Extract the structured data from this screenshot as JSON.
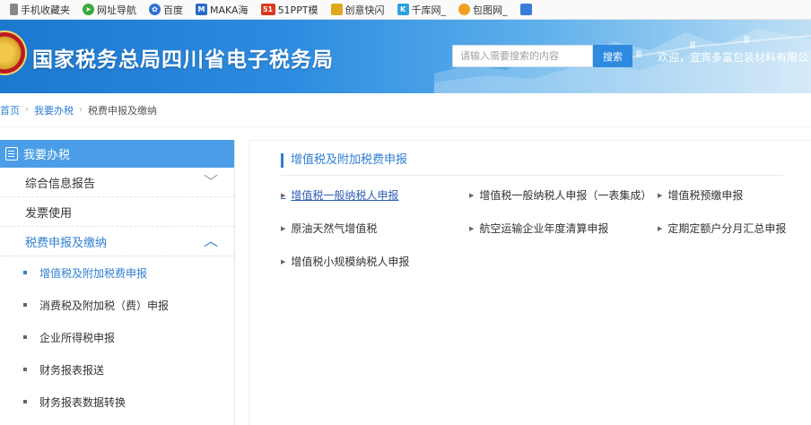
{
  "bookmarks": [
    {
      "label": "手机收藏夹",
      "icon": "phone-icon",
      "color": "#888888"
    },
    {
      "label": "网址导航",
      "icon": "compass-icon",
      "color": "#3aa83a"
    },
    {
      "label": "百度",
      "icon": "baidu-paw-icon",
      "color": "#2f6fd6"
    },
    {
      "label": "MAKA海",
      "icon": "maka-icon",
      "color": "#2a6bc9",
      "glyph": "M"
    },
    {
      "label": "51PPT模",
      "icon": "51ppt-icon",
      "color": "#d9391f",
      "glyph": "51"
    },
    {
      "label": "创意快闪",
      "icon": "folder-icon",
      "color": "#e0a81e"
    },
    {
      "label": "千库网_",
      "icon": "qianku-icon",
      "color": "#2ba3e0",
      "glyph": "K"
    },
    {
      "label": "包图网_",
      "icon": "baotu-icon",
      "color": "#f0a020"
    },
    {
      "label": "",
      "icon": "image-bookmark-icon",
      "color": "#3b7bd9"
    }
  ],
  "header": {
    "site_title": "国家税务总局四川省电子税务局",
    "search_placeholder": "请输入需要搜索的内容",
    "search_button": "搜索",
    "welcome": "欢迎，宜宾多富包装材料有限公"
  },
  "breadcrumb": [
    "首页",
    "我要办税",
    "税费申报及缴纳"
  ],
  "sidebar": {
    "header": "我要办税",
    "sections": [
      {
        "label": "综合信息报告",
        "expanded": false
      },
      {
        "label": "发票使用",
        "expanded": null
      },
      {
        "label": "税费申报及缴纳",
        "expanded": true
      }
    ],
    "sub_items": [
      {
        "label": "增值税及附加税费申报",
        "active": true
      },
      {
        "label": "消费税及附加税（费）申报",
        "active": false
      },
      {
        "label": "企业所得税申报",
        "active": false
      },
      {
        "label": "财务报表报送",
        "active": false
      },
      {
        "label": "财务报表数据转换",
        "active": false
      }
    ]
  },
  "main": {
    "title": "增值税及附加税费申报",
    "links": [
      {
        "label": "增值税一般纳税人申报",
        "current": true
      },
      {
        "label": "增值税一般纳税人申报（一表集成）",
        "current": false
      },
      {
        "label": "增值税预缴申报",
        "current": false
      },
      {
        "label": "原油天然气增值税",
        "current": false
      },
      {
        "label": "航空运输企业年度清算申报",
        "current": false
      },
      {
        "label": "定期定额户分月汇总申报",
        "current": false
      },
      {
        "label": "增值税小规模纳税人申报",
        "current": false
      }
    ]
  },
  "colors": {
    "accent": "#2f7fd1",
    "sidebar_header": "#4a9de6",
    "banner_start": "#1d78cf",
    "banner_end": "#bfdff5"
  }
}
